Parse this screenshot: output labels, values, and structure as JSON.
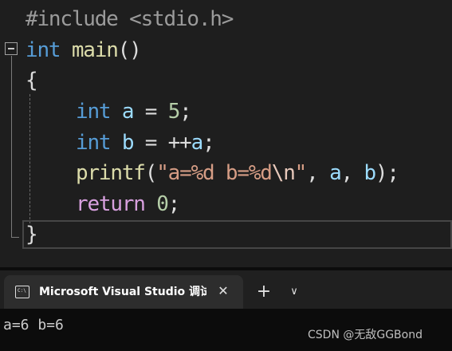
{
  "editor": {
    "line1": {
      "preproc": "#include",
      "header": "<stdio.h>"
    },
    "line2": {
      "type": "int",
      "name": "main",
      "parens": "()"
    },
    "line3": {
      "brace": "{"
    },
    "line4": {
      "type": "int",
      "var": "a",
      "op": " = ",
      "num": "5",
      "end": ";"
    },
    "line5": {
      "type": "int",
      "var": "b",
      "op": " = ++",
      "var2": "a",
      "end": ";"
    },
    "line6": {
      "fn": "printf",
      "open": "(",
      "str1": "\"a=%d b=%d",
      "esc": "\\n",
      "str2": "\"",
      "sep1": ", ",
      "a1": "a",
      "sep2": ", ",
      "a2": "b",
      "close": ");"
    },
    "line7": {
      "kw": "return",
      "num": "0",
      "end": ";"
    },
    "line8": {
      "brace": "}"
    }
  },
  "terminal": {
    "tab_title": "Microsoft Visual Studio 调试控制台",
    "tab_icon_text": "C:\\",
    "close_glyph": "✕",
    "new_tab_glyph": "+",
    "dropdown_glyph": "∨",
    "output": "a=6 b=6"
  },
  "watermark": "CSDN @无敌GGBond"
}
